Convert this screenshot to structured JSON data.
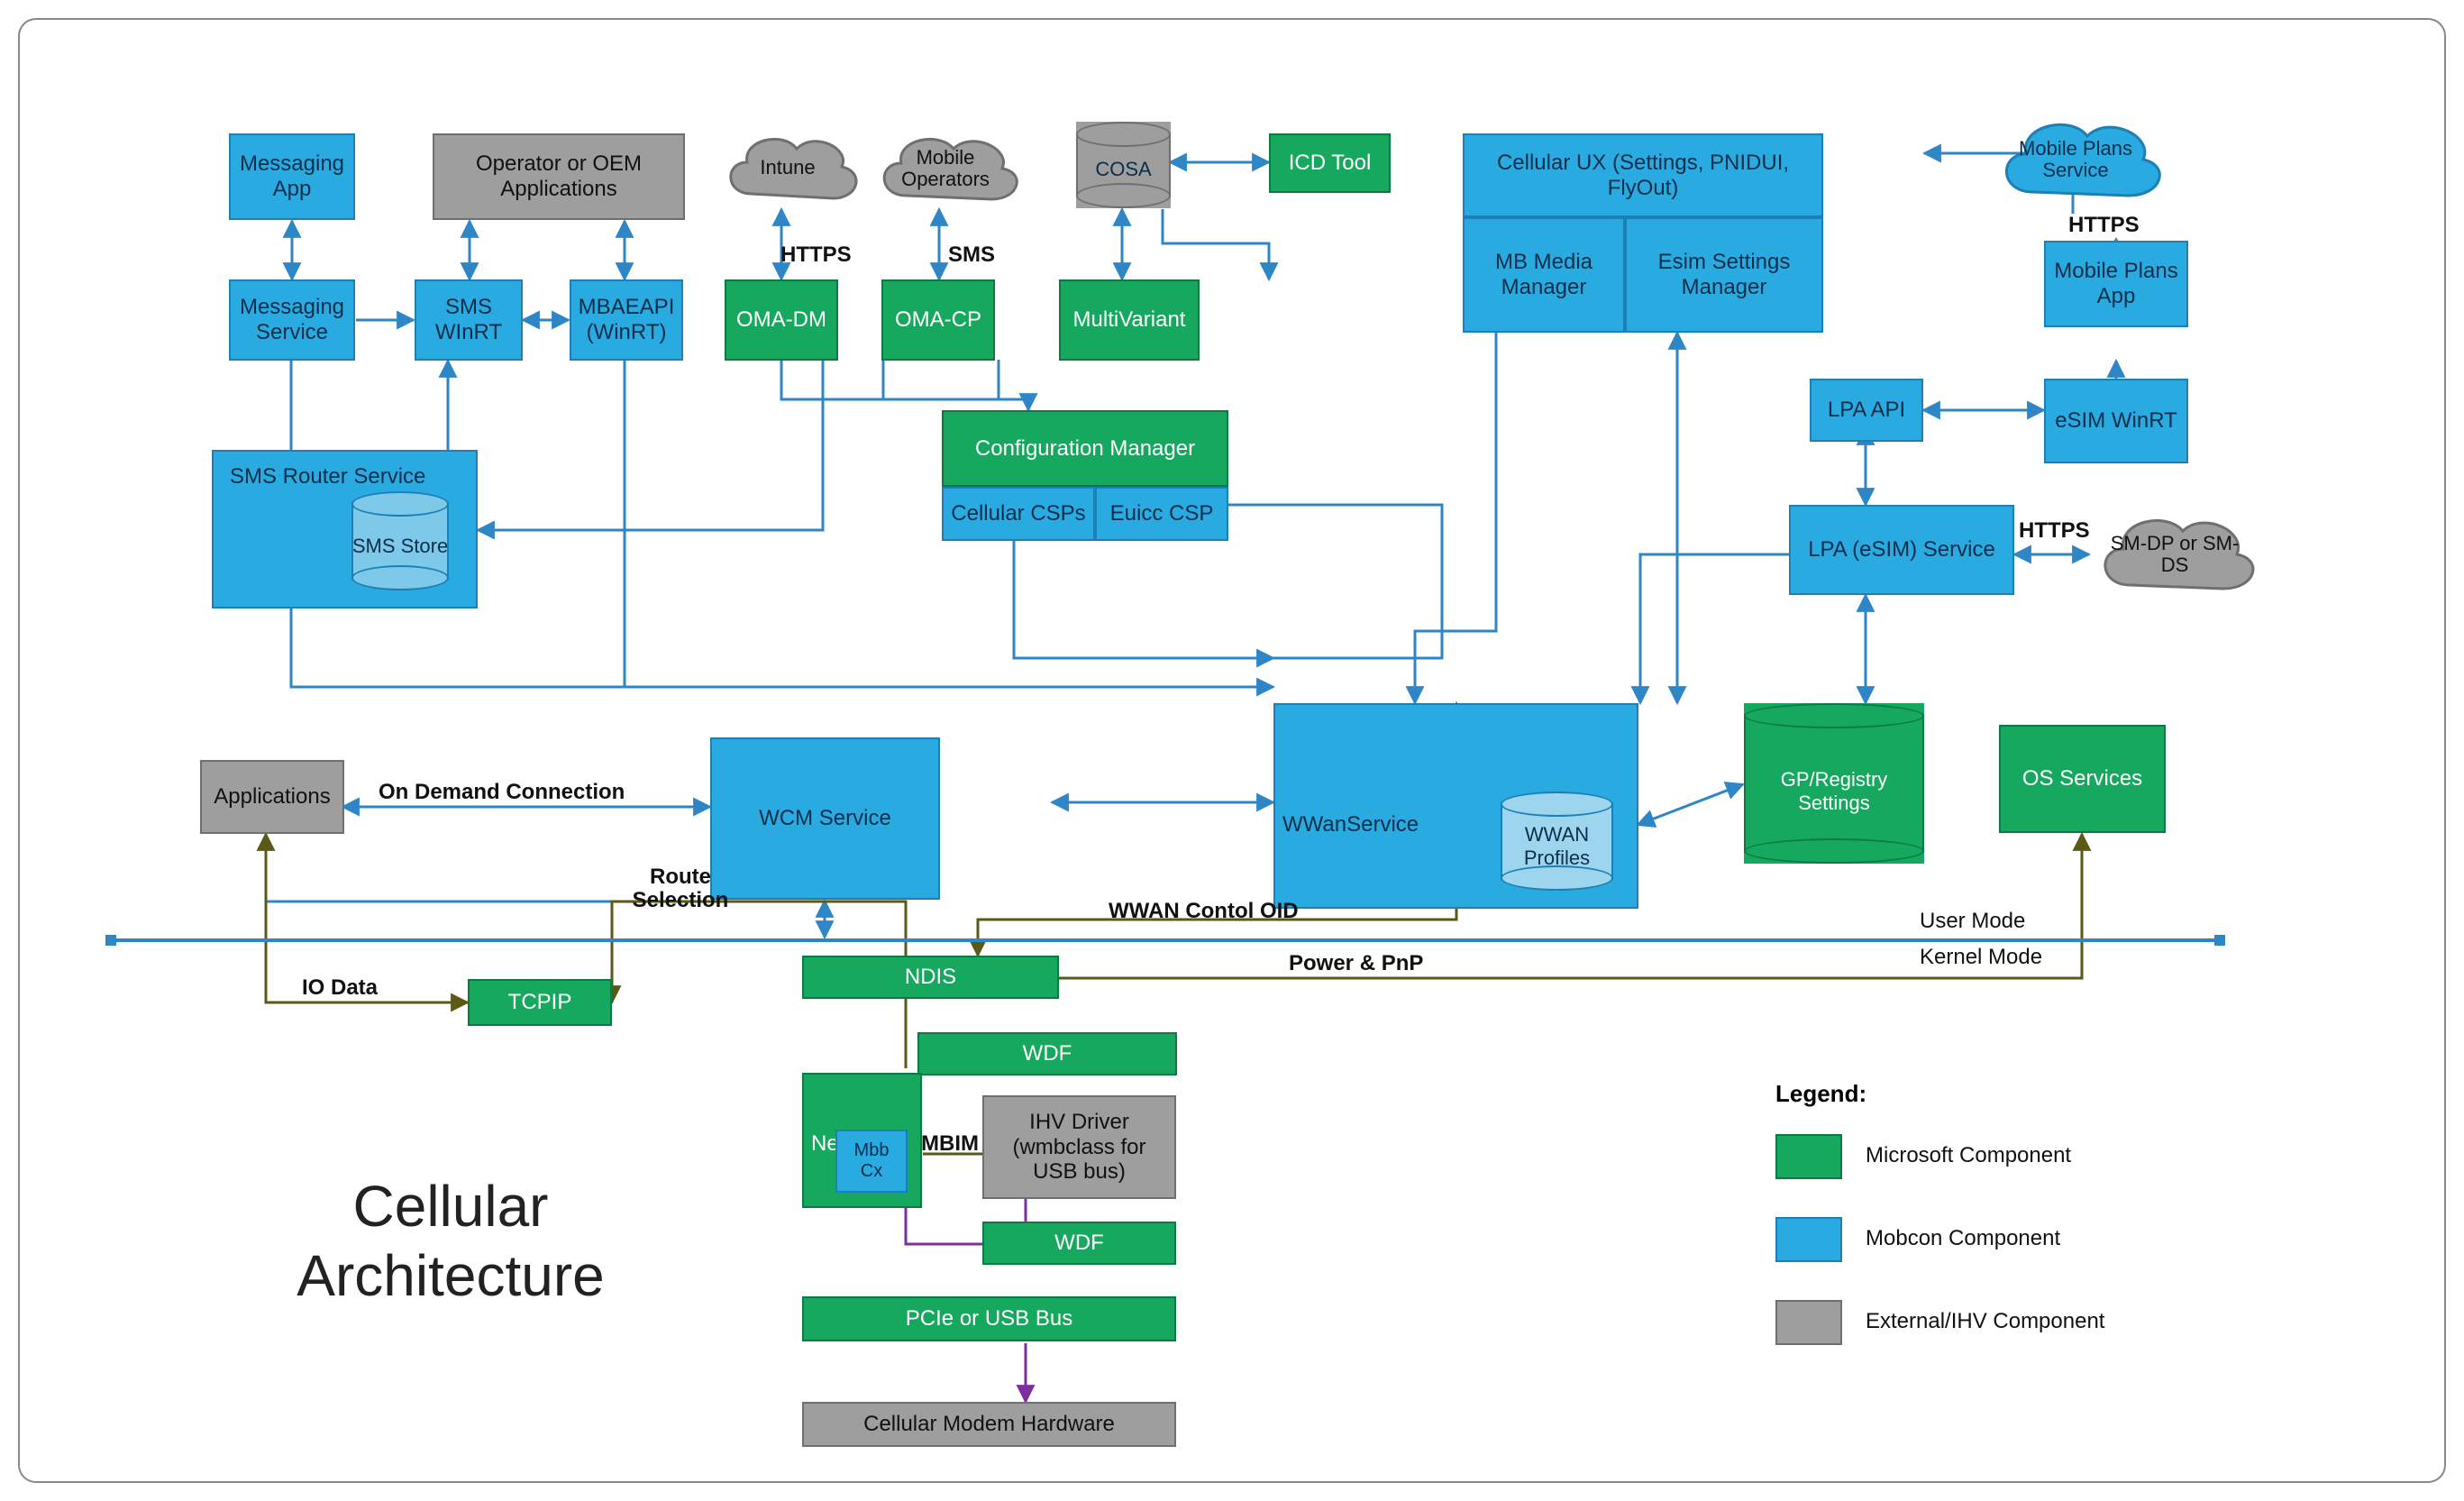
{
  "title_line1": "Cellular",
  "title_line2": "Architecture",
  "edge_labels": {
    "https1": "HTTPS",
    "sms": "SMS",
    "https2": "HTTPS",
    "https3": "HTTPS",
    "on_demand": "On Demand Connection",
    "route_sel": "Route Selection",
    "io_data": "IO Data",
    "wwan_oid": "WWAN Contol OID",
    "power_pnp": "Power & PnP",
    "mbim": "MBIM",
    "user_mode": "User Mode",
    "kernel_mode": "Kernel Mode"
  },
  "nodes": {
    "messaging_app": "Messaging App",
    "operator_oem": "Operator or OEM Applications",
    "intune": "Intune",
    "mobile_operators": "Mobile Operators",
    "cosa": "COSA",
    "icd_tool": "ICD Tool",
    "cellular_ux": "Cellular UX (Settings, PNIDUI, FlyOut)",
    "mobile_plans_service": "Mobile Plans Service",
    "messaging_service": "Messaging Service",
    "sms_winrt": "SMS WInRT",
    "mbae_api": "MBAEAPI (WinRT)",
    "oma_dm": "OMA-DM",
    "oma_cp": "OMA-CP",
    "multivariant": "MultiVariant",
    "mb_media_mgr": "MB Media Manager",
    "esim_settings_mgr": "Esim Settings Manager",
    "mobile_plans_app": "Mobile Plans App",
    "sms_router": "SMS Router Service",
    "sms_store": "SMS Store",
    "config_mgr": "Configuration Manager",
    "cellular_csps": "Cellular CSPs",
    "euicc_csp": "Euicc CSP",
    "lpa_api": "LPA API",
    "esim_winrt": "eSIM WinRT",
    "lpa_service": "LPA (eSIM) Service",
    "smdp": "SM-DP or SM-DS",
    "applications": "Applications",
    "wcm_service": "WCM Service",
    "wwan_service": "WWanService",
    "wwan_profiles": "WWAN Profiles",
    "gp_registry": "GP/Registry Settings",
    "os_services": "OS Services",
    "tcpip": "TCPIP",
    "ndis": "NDIS",
    "wdf1": "WDF",
    "netcx": "NetCx",
    "mbbcx": "Mbb Cx",
    "ihv_driver": "IHV Driver (wmbclass for USB bus)",
    "wdf2": "WDF",
    "pcie_usb": "PCIe or USB Bus",
    "cellular_modem": "Cellular Modem Hardware"
  },
  "legend": {
    "title": "Legend:",
    "ms": "Microsoft Component",
    "mob": "Mobcon Component",
    "ext": "External/IHV Component"
  },
  "colors": {
    "mobcon": "#29abe2",
    "microsoft": "#16a85f",
    "external": "#9e9e9e"
  }
}
